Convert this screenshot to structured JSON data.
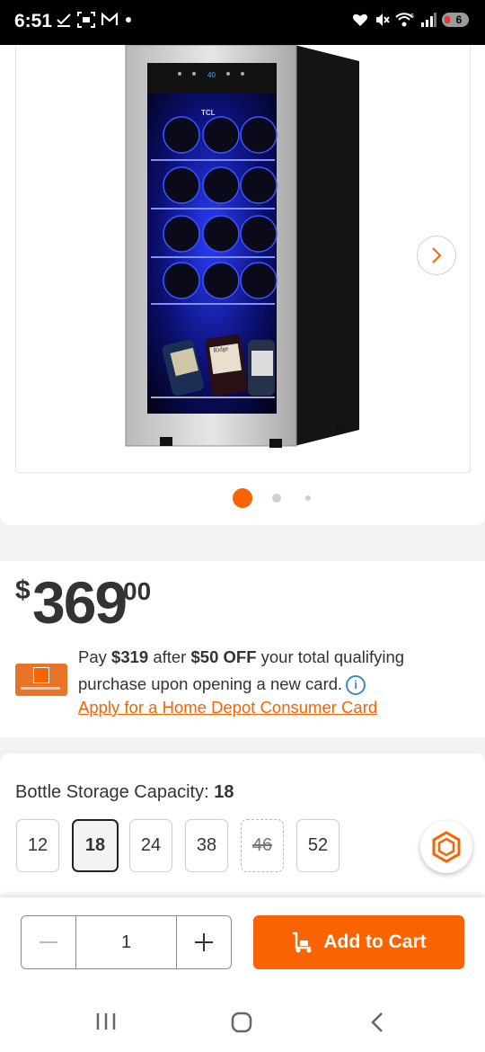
{
  "status_bar": {
    "time": "6:51",
    "battery": "6"
  },
  "product_image": {
    "brand_text": "TCL",
    "bottle_labels": [
      "",
      "Ridge",
      ""
    ],
    "dots_count": 3,
    "active_dot": 0
  },
  "price": {
    "currency": "$",
    "dollars": "369",
    "cents": "00"
  },
  "promo": {
    "pay_prefix": "Pay ",
    "pay_amount": "$319",
    "after_text": " after ",
    "discount": "$50 OFF",
    "rest_text": " your total qualifying purchase upon opening a new card.",
    "apply_link": "Apply for a Home Depot Consumer Card"
  },
  "capacity": {
    "label": "Bottle Storage Capacity: ",
    "selected_value": "18",
    "options": [
      {
        "label": "12",
        "state": "available"
      },
      {
        "label": "18",
        "state": "selected"
      },
      {
        "label": "24",
        "state": "available"
      },
      {
        "label": "38",
        "state": "available"
      },
      {
        "label": "46",
        "state": "unavailable"
      },
      {
        "label": "52",
        "state": "available"
      }
    ]
  },
  "cart": {
    "quantity": "1",
    "add_label": "Add to Cart"
  },
  "colors": {
    "brand_orange": "#f96302",
    "link_blue": "#3e8ac5"
  }
}
